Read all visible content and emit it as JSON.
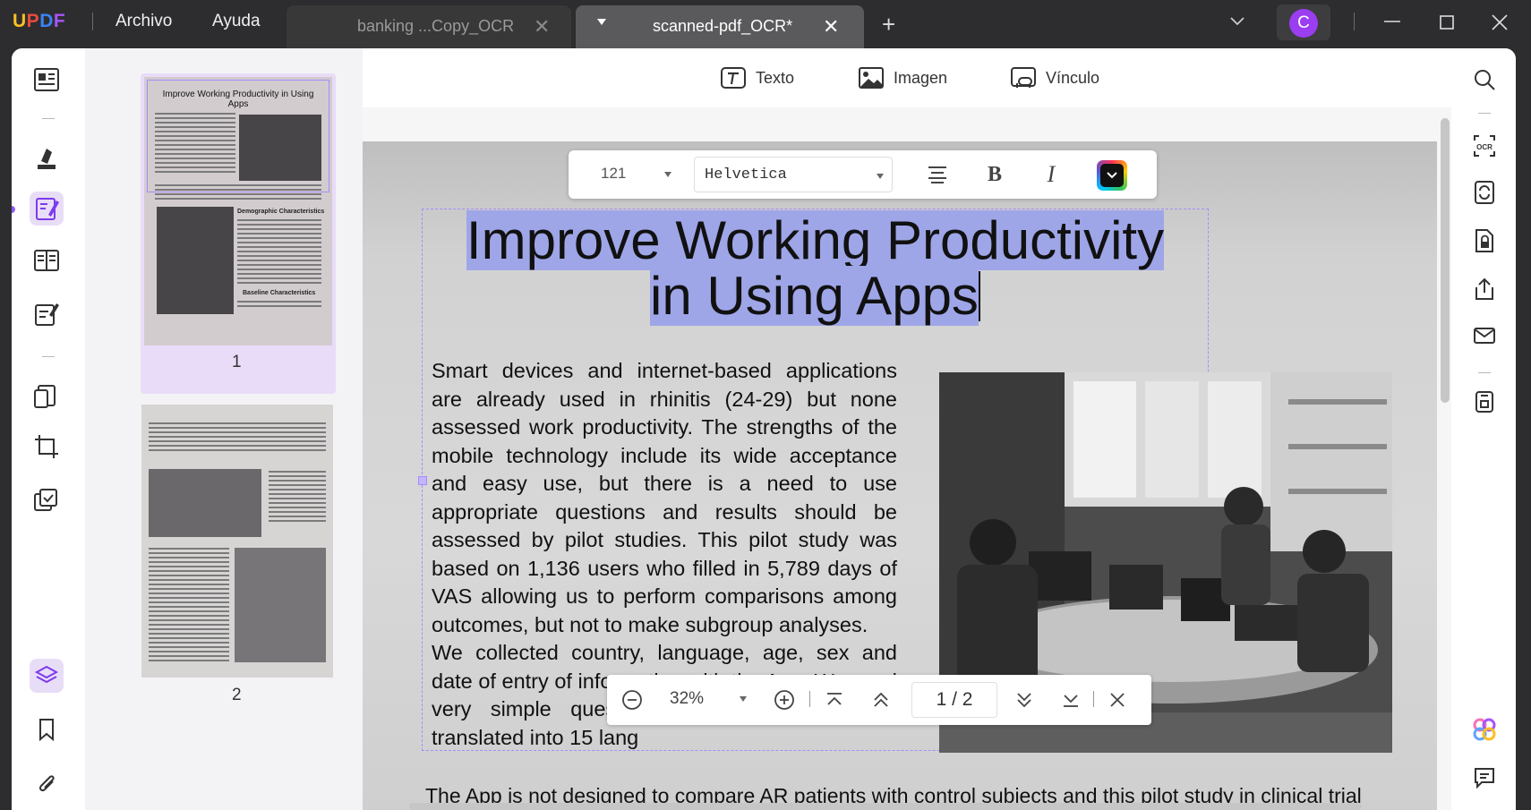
{
  "app": {
    "logo": "UPDF",
    "menu": [
      "Archivo",
      "Ayuda"
    ],
    "tabs": [
      {
        "label": "banking ...Copy_OCR",
        "active": false
      },
      {
        "label": "scanned-pdf_OCR*",
        "active": true
      }
    ],
    "avatar_initial": "C",
    "accent_color": "#8b5cf6",
    "avatar_color": "#9b3df0"
  },
  "edit_toolbar": {
    "text_label": "Texto",
    "image_label": "Imagen",
    "link_label": "Vínculo"
  },
  "format_bar": {
    "font_size": "121",
    "font_family": "Helvetica",
    "bold_label": "B",
    "italic_label": "I"
  },
  "thumbnails": {
    "page1_number": "1",
    "page2_number": "2",
    "page1_title": "Improve Working Productivity in Using Apps",
    "page1_heading1": "Demographic Characteristics",
    "page1_heading2": "Baseline Characteristics"
  },
  "document": {
    "title_line1": "Improve Working Productivity",
    "title_line2": "in Using Apps",
    "paragraph1": "Smart devices and internet-based applications are already used in rhinitis (24-29) but none assessed work productivity. The strengths of the mobile technology include its wide acceptance and easy use, but there is a need to use appropriate questions and results should be assessed by pilot studies. This pilot study was based on 1,136 users who filled in 5,789 days of VAS allowing us to perform comparisons among outcomes, but not to make subgroup analyses.",
    "paragraph2": "We collected country, language, age, sex and date of entry of information with the App. We used very simple questions translated and back-translated into 15 lang",
    "bottom_line": "The App is not designed to compare AR patients with control subjects and this pilot study in clinical trial"
  },
  "zoom_bar": {
    "zoom_value": "32%",
    "page_indicator": "1 / 2"
  }
}
